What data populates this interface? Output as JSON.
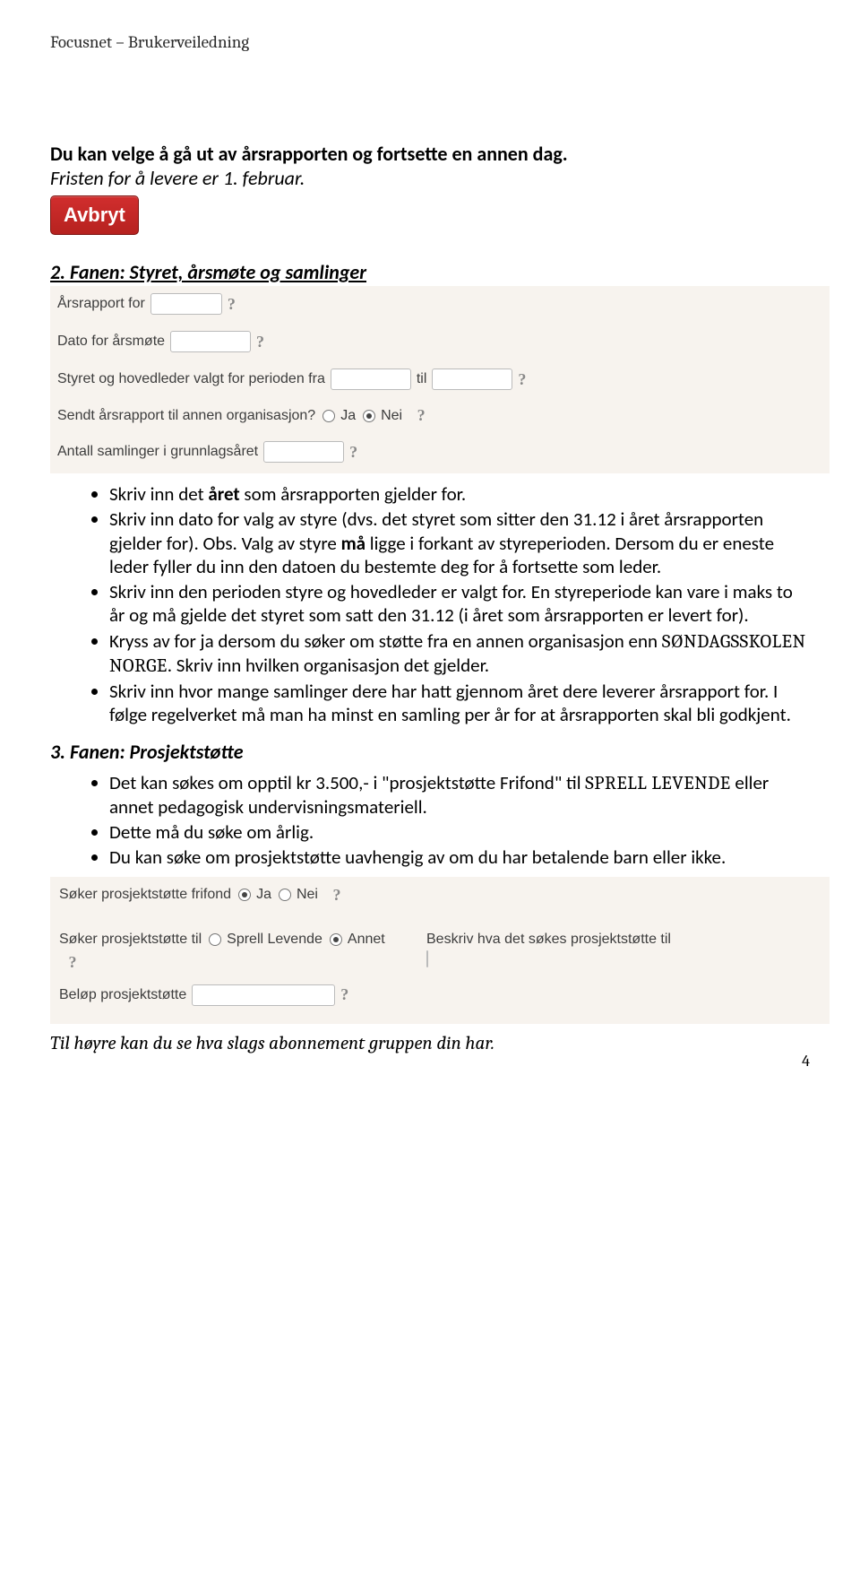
{
  "header": {
    "title": "Focusnet – Brukerveiledning"
  },
  "intro": {
    "line1": "Du kan velge å gå ut av årsrapporten og fortsette en annen dag.",
    "line2": "Fristen for å levere er 1. februar."
  },
  "avbryt_label": "Avbryt",
  "section2": {
    "title": "2. Fanen: Styret, årsmøte og samlinger",
    "form": {
      "arsrapport_for": "Årsrapport for",
      "dato_arsmote": "Dato for årsmøte",
      "periode_fra": "Styret og hovedleder valgt for perioden fra",
      "til": "til",
      "sendt_annen": "Sendt årsrapport til annen organisasjon?",
      "ja": "Ja",
      "nei": "Nei",
      "antall_samlinger": "Antall samlinger i grunnlagsåret",
      "help": "?"
    },
    "bullets": {
      "b1a": "Skriv inn det ",
      "b1b": "året",
      "b1c": " som årsrapporten gjelder for.",
      "b2": "Skriv inn dato for valg av styre (dvs. det styret som sitter den 31.12 i året årsrapporten gjelder for). Obs. Valg av styre ",
      "b2mid": "må",
      "b2end": " ligge i forkant av styreperioden. Dersom du er eneste leder fyller du inn den datoen du bestemte deg for å fortsette som leder.",
      "b3": "Skriv inn den perioden styre og hovedleder er valgt for. En styreperiode kan vare i maks to år og må gjelde det styret som satt den 31.12 (i året som årsrapporten er levert for).",
      "b4a": "Kryss av for ja dersom du søker om støtte fra en annen organisasjon enn ",
      "b4b": "SØNDAGSSKOLEN NORGE",
      "b4c": ". Skriv inn hvilken organisasjon det gjelder.",
      "b5": "Skriv inn hvor mange samlinger dere har hatt gjennom året dere leverer årsrapport for. I følge regelverket må man ha minst en samling per år for at årsrapporten skal bli godkjent."
    }
  },
  "section3": {
    "title": "3. Fanen: Prosjektstøtte",
    "bullets": {
      "b1a": "Det kan søkes om opptil kr 3.500,- i \"prosjektstøtte Frifond\" til ",
      "b1b": "SPRELL LEVENDE",
      "b1c": " eller annet pedagogisk undervisningsmateriell.",
      "b2": "Dette må du søke om årlig.",
      "b3": "Du kan søke om prosjektstøtte uavhengig av om du har betalende barn eller ikke."
    },
    "form": {
      "soker_frifond": "Søker prosjektstøtte frifond",
      "ja": "Ja",
      "nei": "Nei",
      "soker_til": "Søker prosjektstøtte til",
      "sprell": "Sprell Levende",
      "annet": "Annet",
      "beskriv": "Beskriv hva det søkes prosjektstøtte til",
      "belop": "Beløp prosjektstøtte",
      "help": "?"
    }
  },
  "closing": "Til høyre kan du se hva slags abonnement gruppen din har.",
  "page_number": "4"
}
